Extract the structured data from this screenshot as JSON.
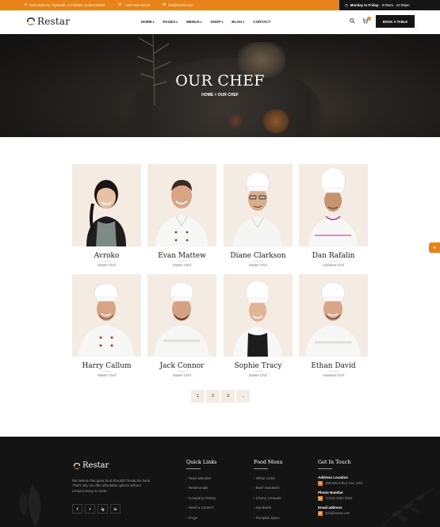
{
  "topbar": {
    "address": "9402 Main St, Plymouth, CA 95669, United States",
    "phone": "+987-629-18415",
    "email": "info@restar.com",
    "hours_label": "Monday to Friday:",
    "hours_value": "9:00am - 22:00pm"
  },
  "header": {
    "logo_text": "Restar",
    "nav": [
      {
        "label": "HOME",
        "dropdown": true
      },
      {
        "label": "PAGES",
        "dropdown": true
      },
      {
        "label": "MENUS",
        "dropdown": true
      },
      {
        "label": "SHOP",
        "dropdown": true
      },
      {
        "label": "BLOG",
        "dropdown": true
      },
      {
        "label": "CONTACT",
        "dropdown": false
      }
    ],
    "cart_count": "0",
    "book_button": "BOOK A TABLE"
  },
  "hero": {
    "title": "OUR CHEF",
    "breadcrumb_home": "HOME",
    "breadcrumb_sep": ">",
    "breadcrumb_current": "OUR CHEF"
  },
  "chefs": [
    {
      "name": "Avroko",
      "role": "Master Chef"
    },
    {
      "name": "Evan Mattew",
      "role": "Master Chef"
    },
    {
      "name": "Diane Clarkson",
      "role": "Master Chef"
    },
    {
      "name": "Dan Rafalin",
      "role": "Assistant Chef"
    },
    {
      "name": "Harry Callum",
      "role": "Master Chef"
    },
    {
      "name": "Jack Connor",
      "role": "Master Chef"
    },
    {
      "name": "Sophie Tracy",
      "role": "Master Chef"
    },
    {
      "name": "Ethan David",
      "role": "Assistant Chef"
    }
  ],
  "pagination": {
    "pages": [
      "1",
      "2",
      "3"
    ],
    "next": "→"
  },
  "footer": {
    "logo_text": "Restar",
    "description": "We believe that great food shouldn't break the bank. That's why we offer affordable options without compromising on taste.",
    "socials": [
      "f",
      "t",
      "ig",
      "in"
    ],
    "quick_links": {
      "title": "Quick Links",
      "items": [
        "Team Member",
        "Testimonials",
        "Company History",
        "Need a Career?",
        "FAQs"
      ]
    },
    "food_menu": {
      "title": "Food Menu",
      "items": [
        "White Coslo",
        "Beef Sandwich",
        "Cherry Limeade",
        "Sandwich",
        "Pumpkin Spice"
      ]
    },
    "get_in_touch": {
      "title": "Get In Touch",
      "address_label": "Address Location",
      "address_value": "158 MacArthur Ave, USA",
      "phone_label": "Phone Number",
      "phone_value": "+(163)-2654-3564",
      "email_label": "Email address",
      "email_value": "info@restar.com"
    }
  },
  "colors": {
    "accent": "#e8831b",
    "dark": "#141414",
    "card_bg": "#f4ece3"
  }
}
